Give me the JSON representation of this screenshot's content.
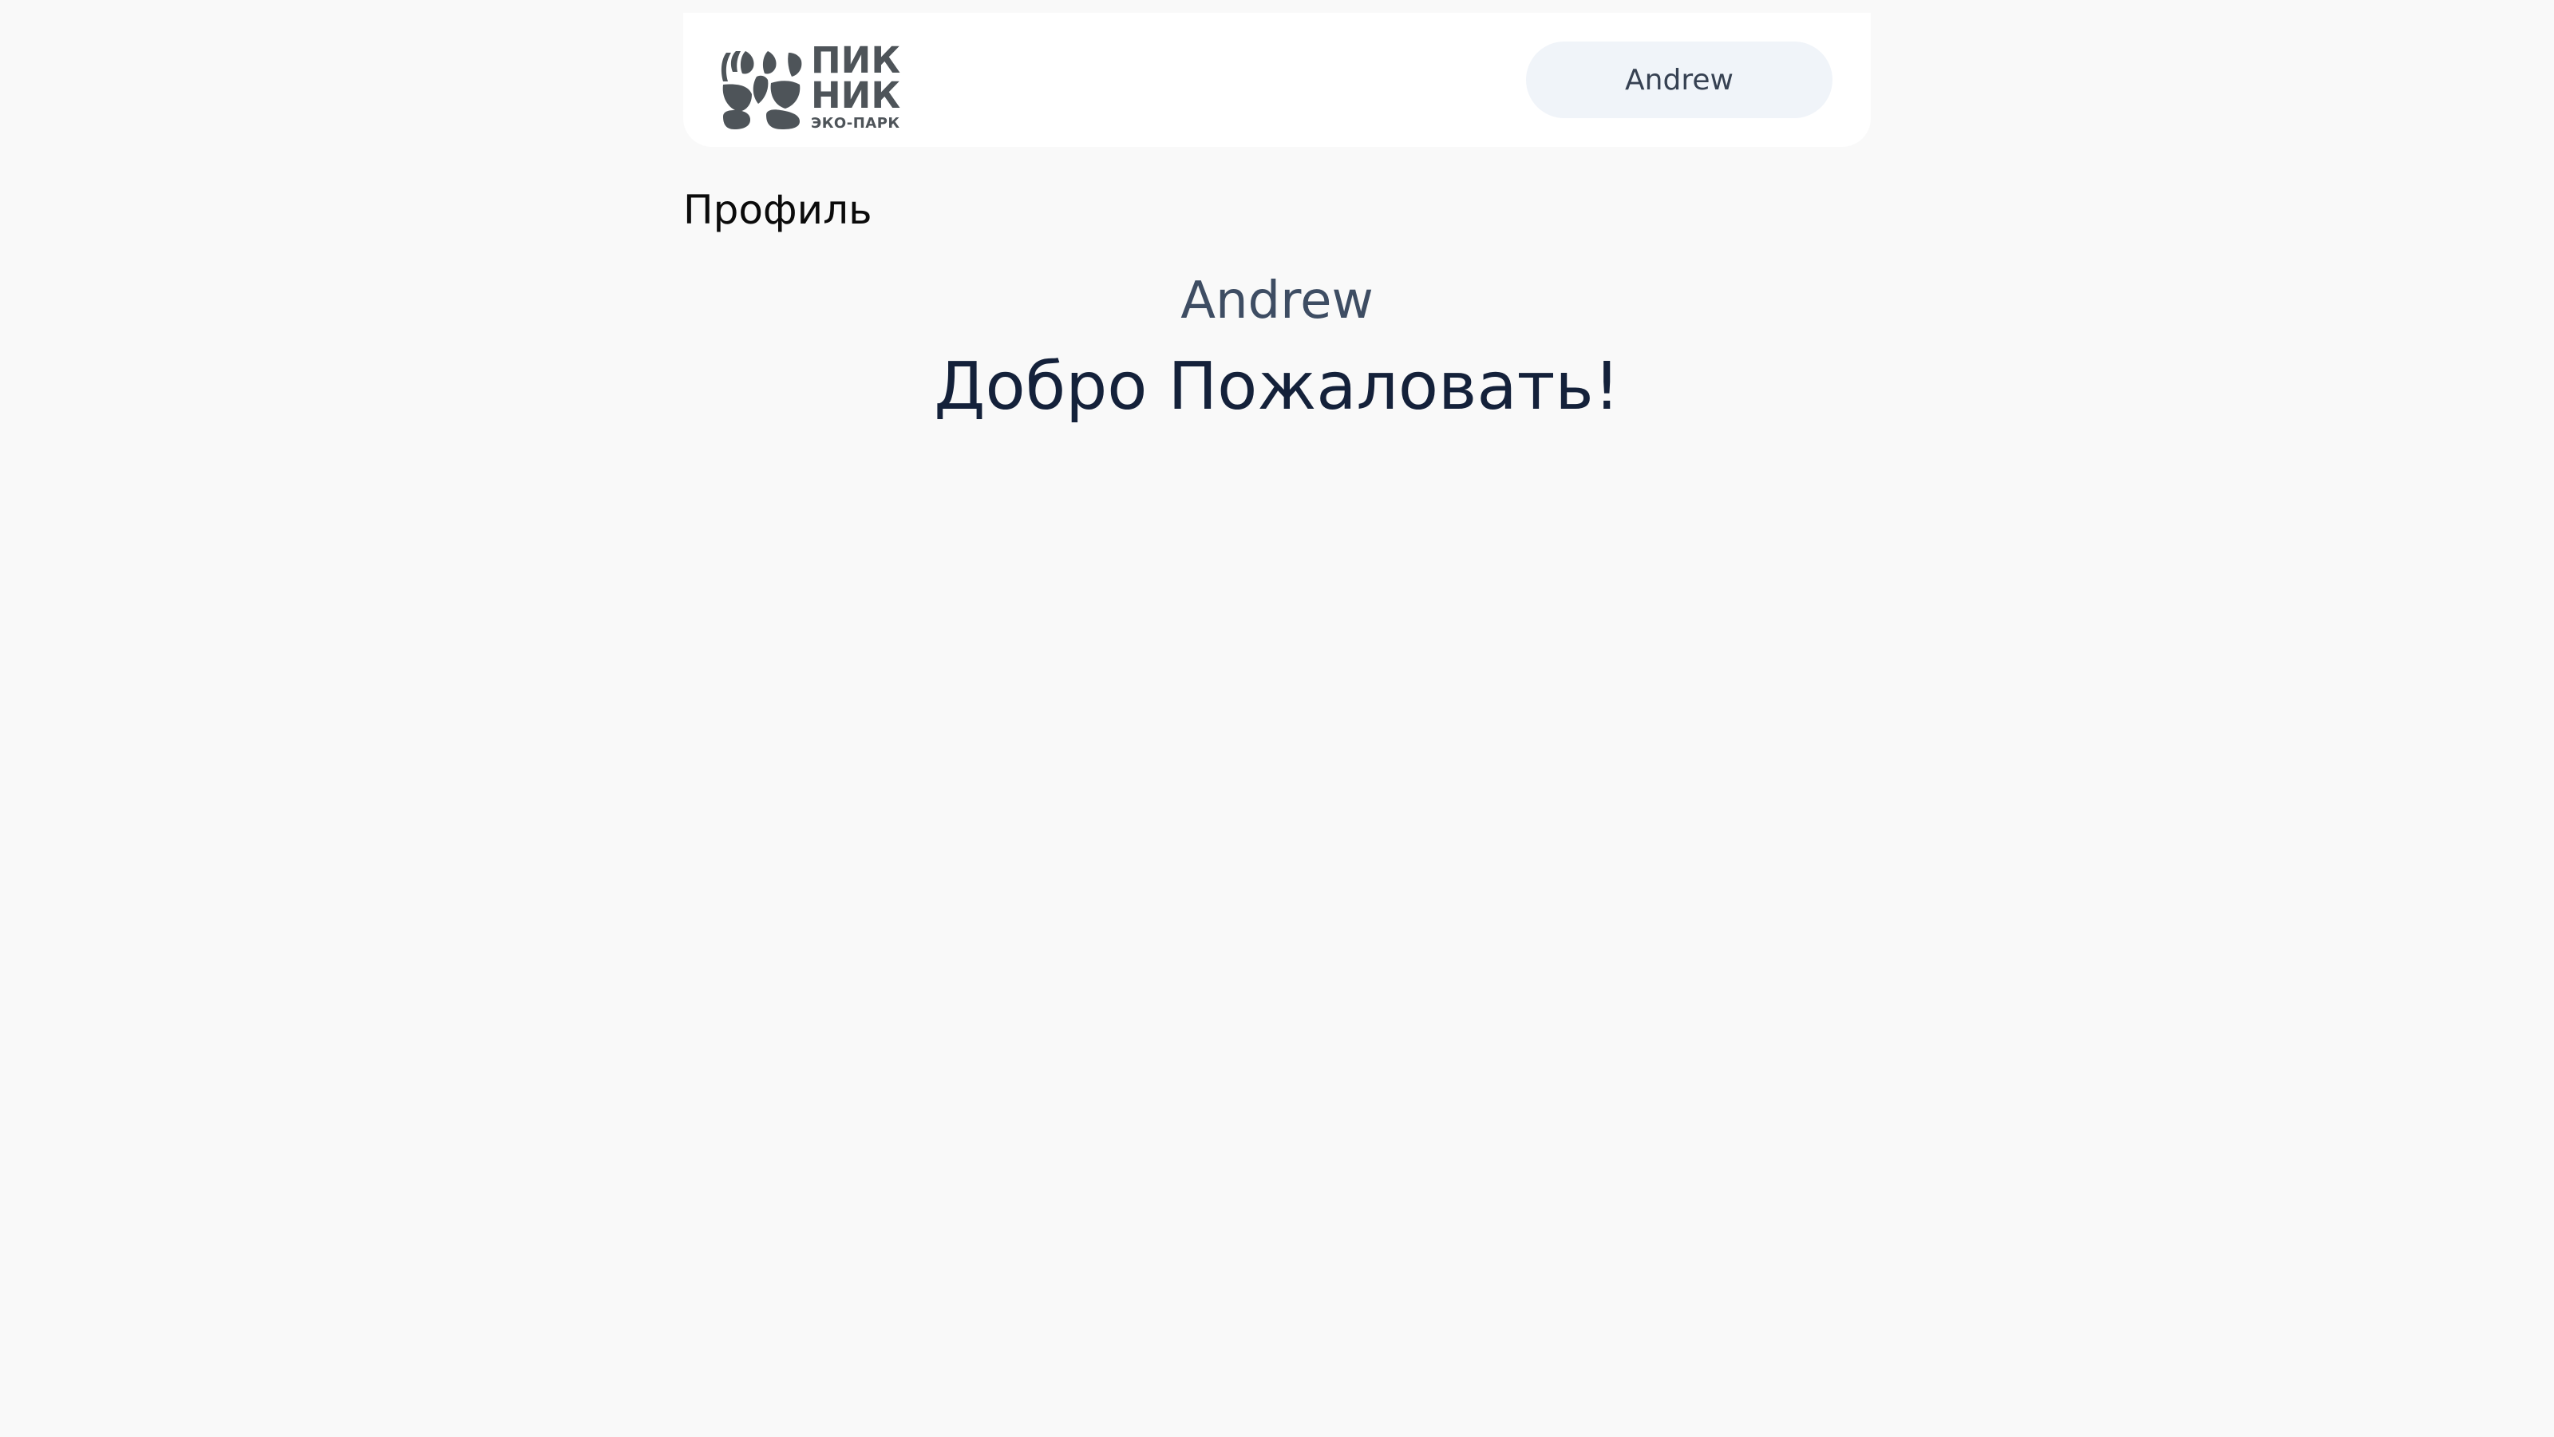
{
  "header": {
    "logo": {
      "line1": "ПИК",
      "line2": "НИК",
      "line3": "ЭКО-ПАРК",
      "icon": "paw-icon",
      "color": "#4e5459"
    },
    "user_button_label": "Andrew"
  },
  "main": {
    "page_title": "Профиль",
    "username": "Andrew",
    "welcome_text": "Добро Пожаловать!"
  },
  "colors": {
    "background": "#f9f9f9",
    "header_background": "#ffffff",
    "pill_background": "#f0f4f9",
    "pill_text": "#364152",
    "username_text": "#3e4d63",
    "welcome_text": "#14213a"
  }
}
